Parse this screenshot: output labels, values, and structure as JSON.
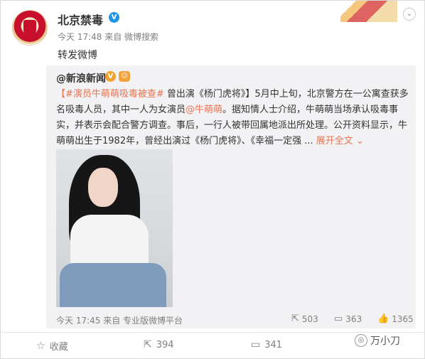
{
  "post": {
    "username": "北京禁毒",
    "meta": "今天 17:48 来自 微博搜索",
    "text": "转发微博"
  },
  "repost": {
    "username": "@新浪新闻",
    "body": {
      "hashtag": "【#演员牛萌萌吸毒被查#",
      "part1": " 曾出演《杨门虎将》】5月中上旬，北京警方在一公寓查获多名吸毒人员，其中一人为女演员",
      "mention": "@牛萌萌",
      "part2": "。据知情人士介绍，牛萌萌当场承认吸毒事实，并表示会配合警方调查。事后，一行人被带回属地派出所处理。公开资料显示，牛萌萌出生于1982年，曾经出演过《杨门虎将》、《幸福一定强 ... ",
      "expand": "展开全文",
      "expand_icon": "chevron-down"
    },
    "meta": "今天 17:45 来自 专业版微博平台",
    "stats": {
      "forward": "503",
      "comment": "363",
      "like": "1365"
    }
  },
  "actions": {
    "favorite_label": "收藏",
    "forward_count": "394",
    "comment_count": "341"
  },
  "watermark": {
    "text": "万小刀"
  },
  "colors": {
    "link": "#eb7350",
    "verify_blue": "#1f93e8",
    "verify_orange": "#f1a22a",
    "muted": "#808080"
  }
}
